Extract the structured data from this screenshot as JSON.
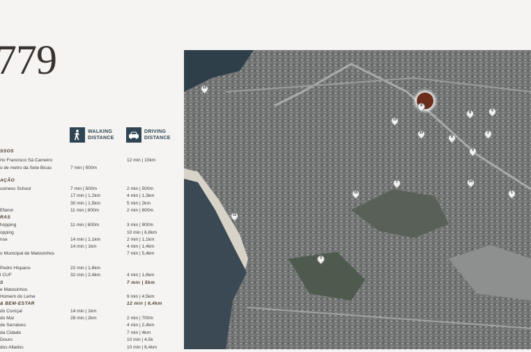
{
  "title": "779",
  "headers": {
    "walking": [
      "WALKING",
      "DISTANCE"
    ],
    "driving": [
      "DRIVING",
      "DISTANCE"
    ],
    "walking_icon": "walking-person-icon",
    "driving_icon": "car-icon"
  },
  "rows": [
    {
      "name": "SSOS",
      "walk": "",
      "drive": "",
      "cat": true
    },
    {
      "name": "rto Francisco Sá Carneiro",
      "walk": "",
      "drive": "12 min | 10km"
    },
    {
      "name": "o de metro da Sete Bicas",
      "walk": "7 min | 500m",
      "drive": ""
    },
    {
      "name": "AÇÃO",
      "walk": "",
      "drive": "",
      "cat": true
    },
    {
      "name": "usiness School",
      "walk": "7 min | 500m",
      "drive": "2 min | 500m"
    },
    {
      "name": "",
      "walk": "17 min | 1,2km",
      "drive": "4 min | 1,3km"
    },
    {
      "name": "",
      "walk": "30 min | 1,5km",
      "drive": "5 min | 2km"
    },
    {
      "name": "Efanor",
      "walk": "11 min | 800m",
      "drive": "2 min | 800m"
    },
    {
      "name": "RAS",
      "walk": "",
      "drive": "",
      "cat": true
    },
    {
      "name": "hopping",
      "walk": "11 min | 800m",
      "drive": "3 min | 900m"
    },
    {
      "name": "opping",
      "walk": "",
      "drive": "10 min | 6,8km"
    },
    {
      "name": "nse",
      "walk": "14 min | 1,1km",
      "drive": "2 min | 1,1km"
    },
    {
      "name": "",
      "walk": "14 min | 1km",
      "drive": "4 min | 1,4km"
    },
    {
      "name": "o Municipal de Matosinhos",
      "walk": "",
      "drive": "7 min | 5,4km"
    },
    {
      "name": "",
      "walk": "",
      "drive": ""
    },
    {
      "name": "Pedro Hispano",
      "walk": "22 min | 1,6km",
      "drive": ""
    },
    {
      "name": "l CUF",
      "walk": "32 min | 2,4km",
      "drive": "4 min | 1,6km"
    },
    {
      "name": "S",
      "walk": "",
      "drive": "7 min | 5km",
      "cat": true
    },
    {
      "name": "e Matosinhos",
      "walk": "",
      "drive": ""
    },
    {
      "name": "Homem do Leme",
      "walk": "",
      "drive": "9 min | 4,5km"
    },
    {
      "name": "& BEM-ESTAR",
      "walk": "",
      "drive": "12 min | 6,4km",
      "cat": true
    },
    {
      "name": "do Corriçal",
      "walk": "14 min | 1km",
      "drive": ""
    },
    {
      "name": "do Mar",
      "walk": "28 min | 2km",
      "drive": "2 min | 700m"
    },
    {
      "name": "de Serralves",
      "walk": "",
      "drive": "4 min | 2,4km"
    },
    {
      "name": "da Cidade",
      "walk": "",
      "drive": "7 min | 4km"
    },
    {
      "name": "Douro",
      "walk": "",
      "drive": "10 min | 4,5k"
    },
    {
      "name": "dos Aliados",
      "walk": "",
      "drive": "10 min | 6,4km"
    }
  ],
  "map": {
    "pins": [
      "12",
      "4",
      "13",
      "10",
      "6",
      "7",
      "8",
      "5",
      "2",
      "9",
      "11",
      "15",
      "3",
      "14",
      "1"
    ],
    "location_marker": "property-location"
  }
}
